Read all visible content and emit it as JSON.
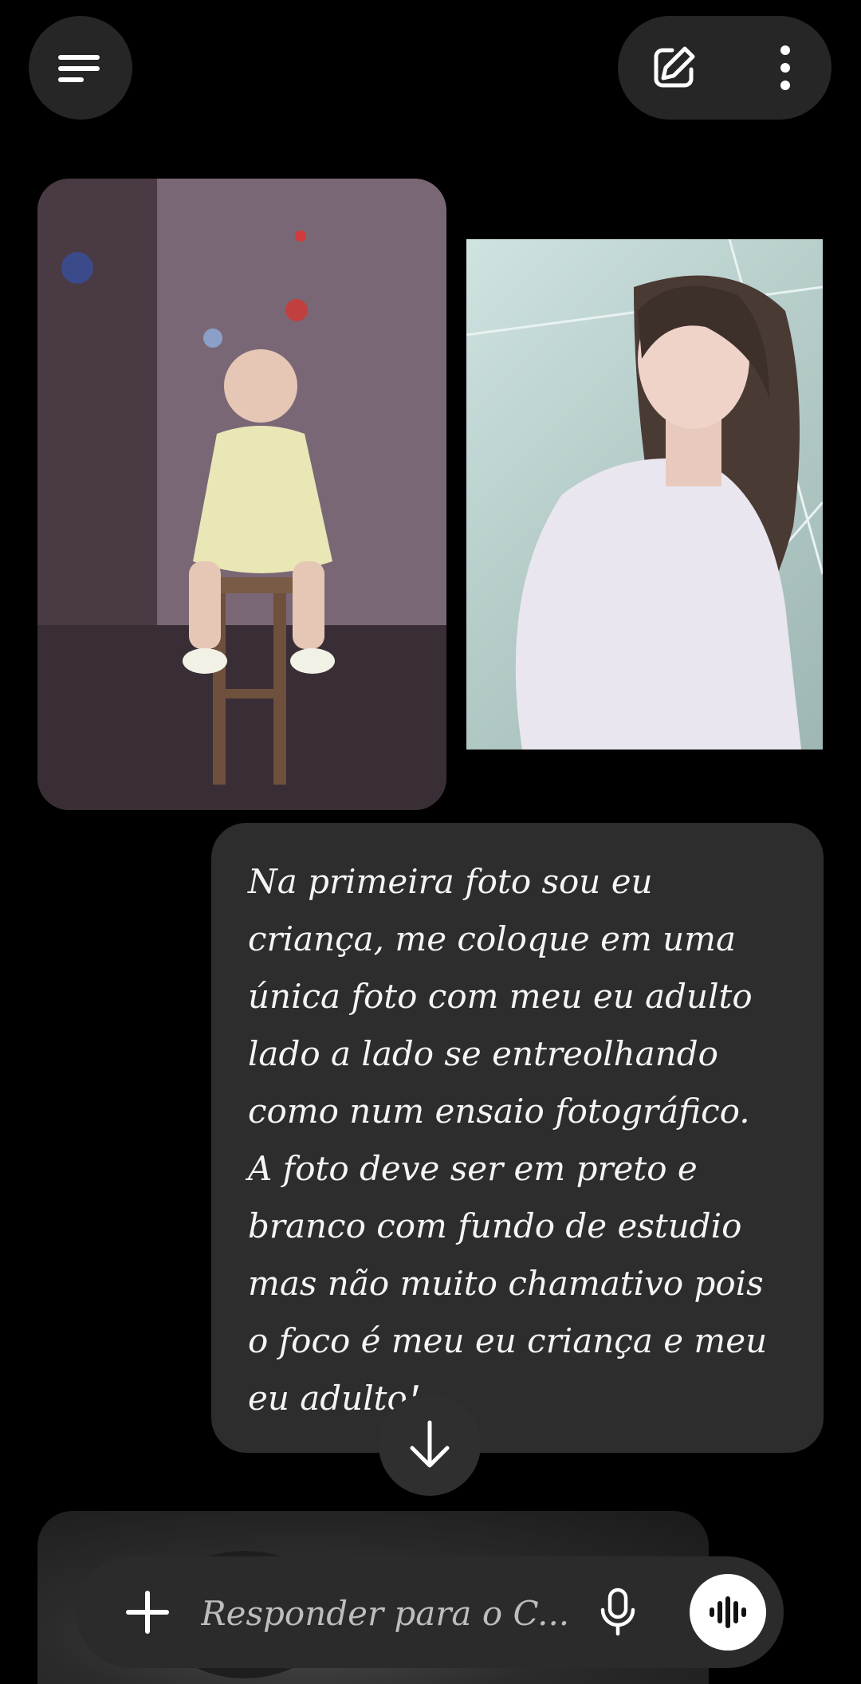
{
  "header": {
    "menu_icon": "menu-icon",
    "edit_icon": "edit-icon",
    "more_icon": "more-vertical-icon"
  },
  "images": {
    "child_photo": "child-photo",
    "adult_photo": "adult-photo"
  },
  "message": {
    "text": "Na primeira foto sou eu\ncriança, me coloque em uma\núnica foto com meu eu adulto\nlado a lado se entreolhando\ncomo num ensaio fotográfico.\nA foto deve ser em preto e\nbranco com fundo de estudio\nmas não muito chamativo pois\no foco é meu eu criança e meu\neu adulto!"
  },
  "scroll_button": {
    "icon": "arrow-down-icon"
  },
  "composer": {
    "placeholder": "Responder para o C...",
    "plus_icon": "plus-icon",
    "mic_icon": "microphone-icon",
    "voice_icon": "voice-waveform-icon"
  }
}
